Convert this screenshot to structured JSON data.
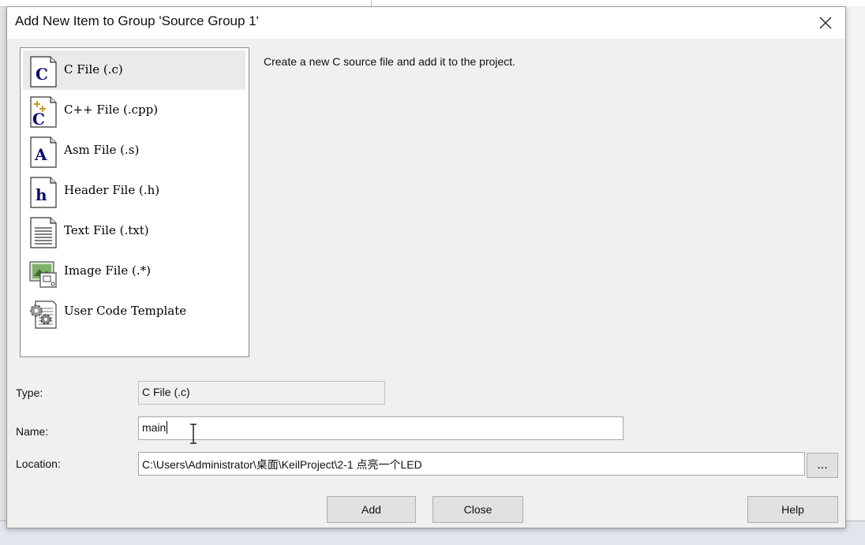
{
  "dialog": {
    "title": "Add New Item to Group 'Source Group 1'",
    "description": "Create a new C source file and add it to the project."
  },
  "file_types": [
    {
      "label": "C File (.c)",
      "icon": "c-file-icon",
      "selected": true
    },
    {
      "label": "C++ File (.cpp)",
      "icon": "cpp-file-icon",
      "selected": false
    },
    {
      "label": "Asm File (.s)",
      "icon": "asm-file-icon",
      "selected": false
    },
    {
      "label": "Header File (.h)",
      "icon": "header-file-icon",
      "selected": false
    },
    {
      "label": "Text File (.txt)",
      "icon": "text-file-icon",
      "selected": false
    },
    {
      "label": "Image File (.*)",
      "icon": "image-file-icon",
      "selected": false
    },
    {
      "label": "User Code Template",
      "icon": "user-code-template-icon",
      "selected": false
    }
  ],
  "fields": {
    "type_label": "Type:",
    "type_value": "C File (.c)",
    "name_label": "Name:",
    "name_value": "main",
    "location_label": "Location:",
    "location_value": "C:\\Users\\Administrator\\桌面\\KeilProject\\2-1 点亮一个LED"
  },
  "buttons": {
    "browse": "...",
    "add": "Add",
    "close": "Close",
    "help": "Help"
  }
}
